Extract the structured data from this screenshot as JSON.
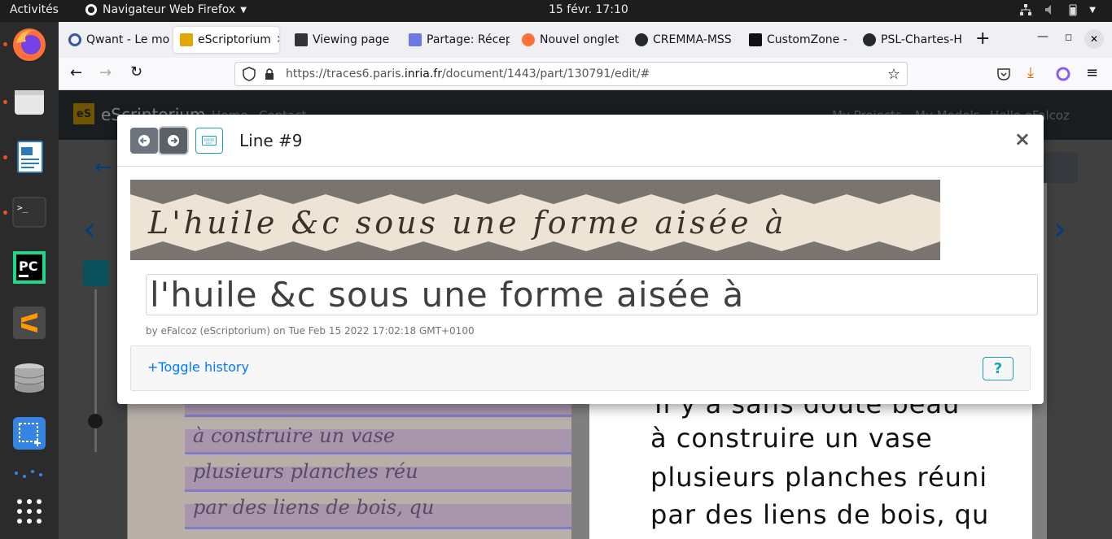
{
  "topbar": {
    "activities": "Activités",
    "app_name": "Navigateur Web Firefox",
    "clock": "15 févr.  17:10"
  },
  "tabs": [
    {
      "label": "Qwant - Le mo",
      "color": "#3b5998"
    },
    {
      "label": "eScriptorium",
      "color": "#e0a800",
      "active": true
    },
    {
      "label": "Viewing page",
      "color": "#333333"
    },
    {
      "label": "Partage: Récep",
      "color": "#6a7ae0"
    },
    {
      "label": "Nouvel onglet",
      "color": "#ff7139"
    },
    {
      "label": "CREMMA-MSS",
      "color": "#24292e"
    },
    {
      "label": "CustomZone -",
      "color": "#111111"
    },
    {
      "label": "PSL-Chartes-H",
      "color": "#24292e"
    }
  ],
  "url": {
    "prefix": "https://traces6.paris.",
    "domain": "inria.fr",
    "suffix": "/document/1443/part/130791/edit/#"
  },
  "site": {
    "brand": "eScriptorium",
    "nav_home": "Home",
    "nav_contact": "Contact",
    "nav_projects": "My Projects",
    "nav_models": "My Models",
    "nav_user": "Hello eFalcoz"
  },
  "modal": {
    "title": "Line #9",
    "transcription": "l'huile &c sous une forme aisée à",
    "byline": "by eFalcoz (eScriptorium) on Tue Feb 15 2022 17:02:18 GMT+0100",
    "toggle_history": "+Toggle history",
    "help": "?",
    "manuscript_text": "L'huile &c sous une forme aisée à"
  },
  "background_text": {
    "line1": "Il y a sans doute beau",
    "line2": "à construire un vase",
    "line3": "plusieurs planches réuni",
    "line4": "par des liens de bois, qu"
  },
  "background_manuscript": {
    "line1": "à construire un vase",
    "line2": "plusieurs planches réu",
    "line3": "par des liens de bois, qu"
  }
}
